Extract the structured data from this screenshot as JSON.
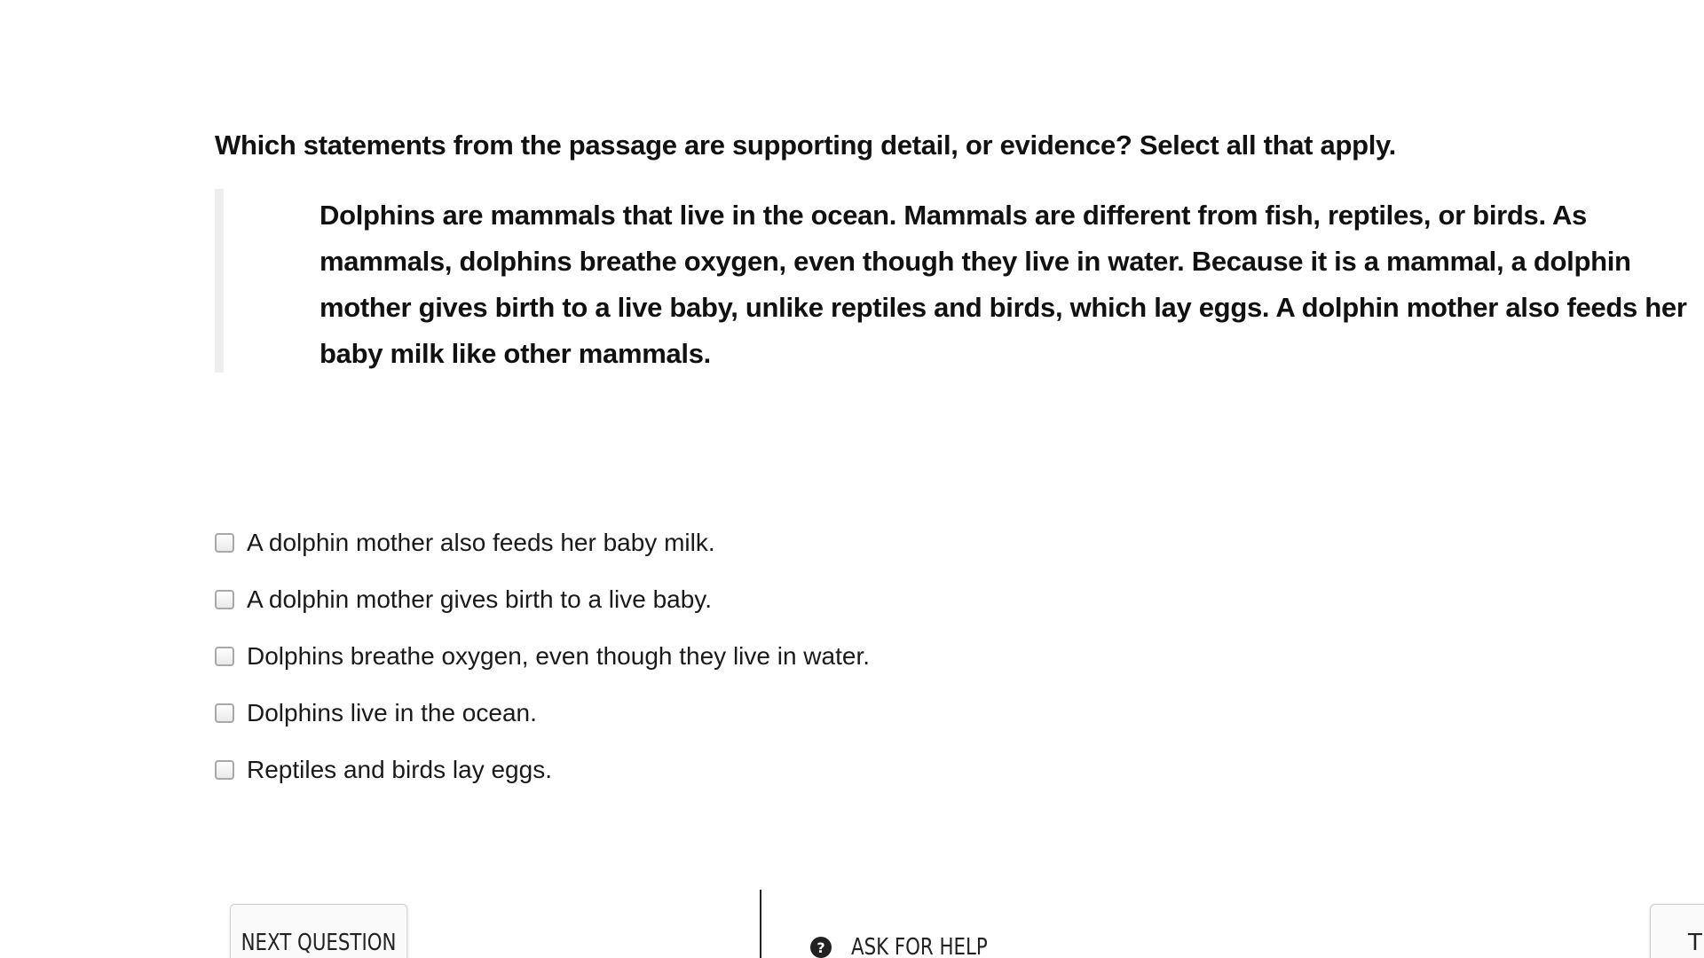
{
  "question": {
    "prompt": "Which statements from the passage are supporting detail, or evidence? Select all that apply."
  },
  "passage": {
    "text": "Dolphins are mammals that live in the ocean. Mammals are different from fish, reptiles, or birds. As mammals, dolphins breathe oxygen, even though they live in water. Because it is a mammal, a dolphin mother gives birth to a live baby, unlike reptiles and birds, which lay eggs. A dolphin mother also feeds her baby milk like other mammals."
  },
  "options": [
    {
      "label": "A dolphin mother also feeds her baby milk.",
      "checked": false
    },
    {
      "label": "A dolphin mother gives birth to a live baby.",
      "checked": false
    },
    {
      "label": "Dolphins breathe oxygen, even though they live in water.",
      "checked": false
    },
    {
      "label": "Dolphins live in the ocean.",
      "checked": false
    },
    {
      "label": "Reptiles and birds lay eggs.",
      "checked": false
    }
  ],
  "footer": {
    "next_label": "NEXT QUESTION",
    "help_label": "ASK FOR HELP",
    "help_icon": "question-circle-icon",
    "right_button_label": "TU"
  }
}
